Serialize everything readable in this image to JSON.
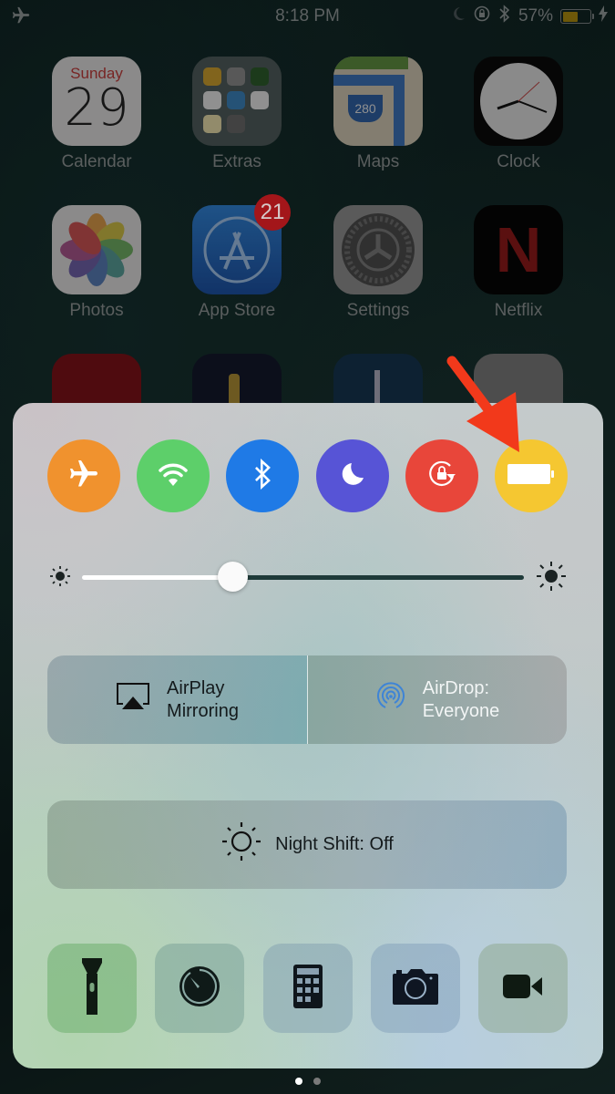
{
  "status_bar": {
    "time": "8:18 PM",
    "battery_percent_label": "57%",
    "battery_level": 0.57,
    "icons": [
      "airplane-mode-icon",
      "do-not-disturb-icon",
      "orientation-lock-icon",
      "bluetooth-icon",
      "battery-icon",
      "charging-bolt-icon"
    ]
  },
  "home_screen": {
    "apps": [
      {
        "name": "Calendar",
        "day": "Sunday",
        "date": "29"
      },
      {
        "name": "Extras"
      },
      {
        "name": "Maps",
        "route": "280"
      },
      {
        "name": "Clock"
      },
      {
        "name": "Photos"
      },
      {
        "name": "App Store",
        "badge": "21"
      },
      {
        "name": "Settings"
      },
      {
        "name": "Netflix",
        "glyph": "N"
      }
    ]
  },
  "control_center": {
    "toggles": [
      {
        "id": "airplane-mode",
        "icon": "airplane-icon",
        "color": "#f0922e"
      },
      {
        "id": "wifi",
        "icon": "wifi-icon",
        "color": "#5dcf6a"
      },
      {
        "id": "bluetooth",
        "icon": "bluetooth-icon",
        "color": "#1f7ae6"
      },
      {
        "id": "do-not-disturb",
        "icon": "moon-icon",
        "color": "#5754d6"
      },
      {
        "id": "orientation-lock",
        "icon": "rotation-lock-icon",
        "color": "#e8463a"
      },
      {
        "id": "low-power-mode",
        "icon": "battery-icon",
        "color": "#f5c731"
      }
    ],
    "brightness": {
      "value": 0.34
    },
    "airplay": {
      "line1": "AirPlay",
      "line2": "Mirroring"
    },
    "airdrop": {
      "line1": "AirDrop:",
      "line2": "Everyone"
    },
    "night_shift": {
      "label": "Night Shift: Off"
    },
    "tools": [
      {
        "id": "flashlight",
        "icon": "flashlight-icon"
      },
      {
        "id": "timer",
        "icon": "timer-icon"
      },
      {
        "id": "calculator",
        "icon": "calculator-icon"
      },
      {
        "id": "camera",
        "icon": "camera-icon"
      },
      {
        "id": "video",
        "icon": "video-camera-icon"
      }
    ],
    "page_count": 2,
    "current_page": 1
  },
  "annotation": {
    "arrow_color": "#f2391b"
  }
}
